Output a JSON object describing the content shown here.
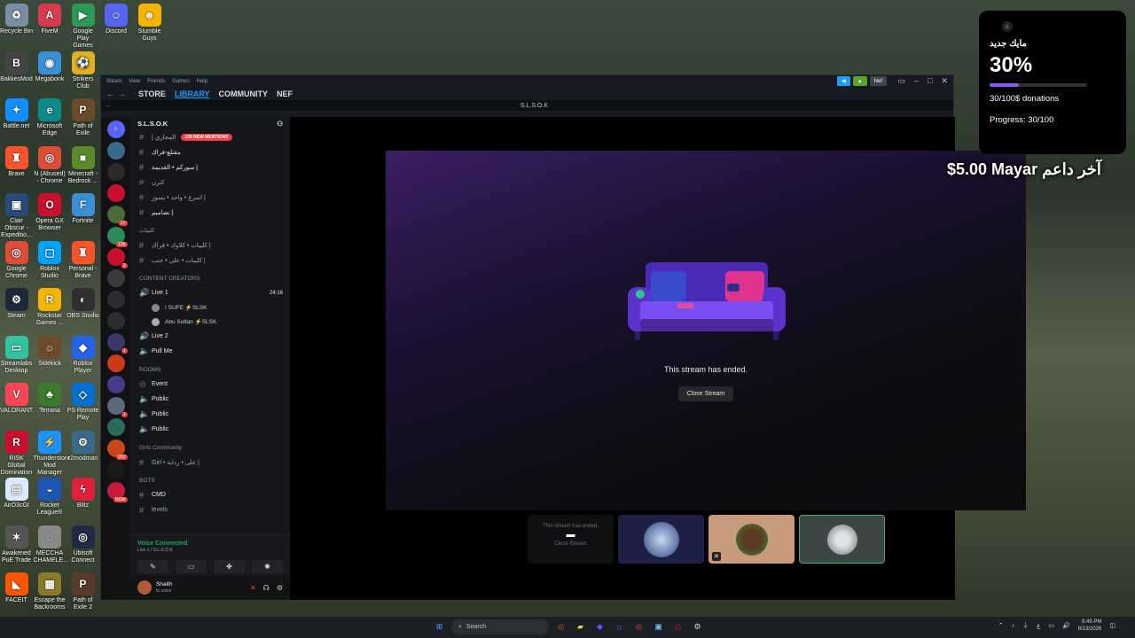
{
  "desktop": {
    "icons": [
      {
        "label": "Recycle Bin",
        "color": "#7b8ea3",
        "glyph": "♻"
      },
      {
        "label": "FiveM",
        "color": "#d63b4f",
        "glyph": "A"
      },
      {
        "label": "Google Play Games",
        "color": "#2a9a55",
        "glyph": "▶"
      },
      {
        "label": "Discord",
        "color": "#5865f2",
        "glyph": "☺"
      },
      {
        "label": "Stumble Guys",
        "color": "#f5b400",
        "glyph": "☻"
      },
      {
        "label": "BakkesMod",
        "color": "#444",
        "glyph": "B"
      },
      {
        "label": "Megabonk",
        "color": "#3a8fd6",
        "glyph": "◉"
      },
      {
        "label": "Strikers Club",
        "color": "#e0b020",
        "glyph": "⚽"
      },
      {
        "label": "Battle.net",
        "color": "#148eff",
        "glyph": "✦"
      },
      {
        "label": "Microsoft Edge",
        "color": "#0c8a8a",
        "glyph": "e"
      },
      {
        "label": "Path of Exile",
        "color": "#6b4b2a",
        "glyph": "P"
      },
      {
        "label": "Brave",
        "color": "#fb542b",
        "glyph": "♜"
      },
      {
        "label": "N (Abused) - Chrome",
        "color": "#dd4b39",
        "glyph": "◎"
      },
      {
        "label": "Minecraft - Bedrock ...",
        "color": "#5a8a2a",
        "glyph": "■"
      },
      {
        "label": "Clair Obscur - Expeditio...",
        "color": "#2a4a7a",
        "glyph": "▣"
      },
      {
        "label": "Opera GX Browser",
        "color": "#c8102e",
        "glyph": "O"
      },
      {
        "label": "Fortnite",
        "color": "#3a8fd6",
        "glyph": "F"
      },
      {
        "label": "Google Chrome",
        "color": "#dd4b39",
        "glyph": "◎"
      },
      {
        "label": "Roblox Studio",
        "color": "#00a2ff",
        "glyph": "▢"
      },
      {
        "label": "Personal - Brave",
        "color": "#fb542b",
        "glyph": "♜"
      },
      {
        "label": "Steam",
        "color": "#1b2838",
        "glyph": "⚙"
      },
      {
        "label": "Rockstar Games ...",
        "color": "#f5b400",
        "glyph": "R"
      },
      {
        "label": "OBS Studio",
        "color": "#302e31",
        "glyph": "◐"
      },
      {
        "label": "Streamlabs Desktop",
        "color": "#31c3a2",
        "glyph": "▭"
      },
      {
        "label": "Sidekick",
        "color": "#6b4b2a",
        "glyph": "☼"
      },
      {
        "label": "Roblox Player",
        "color": "#2563eb",
        "glyph": "◆"
      },
      {
        "label": "VALORANT",
        "color": "#ff4655",
        "glyph": "V"
      },
      {
        "label": "Terraria",
        "color": "#3a7a2a",
        "glyph": "♣"
      },
      {
        "label": "PS Remote Play",
        "color": "#0070d1",
        "glyph": "◇"
      },
      {
        "label": "RISK Global Domination",
        "color": "#c8102e",
        "glyph": "R"
      },
      {
        "label": "Thunderstore Mod Manager",
        "color": "#1e90ff",
        "glyph": "⚡"
      },
      {
        "label": "r2modman",
        "color": "#3a6a8a",
        "glyph": "⚙"
      },
      {
        "label": "AirO3cGt",
        "color": "#dbeafe",
        "glyph": "▤"
      },
      {
        "label": "Rocket League®",
        "color": "#1e56b5",
        "glyph": "◒"
      },
      {
        "label": "Blitz",
        "color": "#e0203a",
        "glyph": "ϟ"
      },
      {
        "label": "Awakened PoE Trade",
        "color": "#555",
        "glyph": "✶"
      },
      {
        "label": "MECCHA CHAMELE...",
        "color": "#888",
        "glyph": "◌"
      },
      {
        "label": "Ubisoft Connect",
        "color": "#1f2a44",
        "glyph": "◎"
      },
      {
        "label": "FACEIT",
        "color": "#ff5500",
        "glyph": "◣"
      },
      {
        "label": "Escape the Backrooms",
        "color": "#8a7a2a",
        "glyph": "▦"
      },
      {
        "label": "Path of Exile 2",
        "color": "#5a3a2a",
        "glyph": "P"
      },
      {
        "label": "Infinite Backroo...",
        "color": "#3a3a3a",
        "glyph": "▥"
      }
    ]
  },
  "steam": {
    "menu": [
      "Steam",
      "View",
      "Friends",
      "Games",
      "Help"
    ],
    "nav": {
      "store": "STORE",
      "library": "LIBRARY",
      "community": "COMMUNITY",
      "user": "NEF"
    },
    "tab_title": "S.L.S.O.K",
    "user_menu": "Nef"
  },
  "discord": {
    "server_name": "S.L.S.O.K",
    "mentions_pill": "126 NEW MENTIONS",
    "channels": [
      {
        "name": "| المجاري",
        "type": "text"
      },
      {
        "name": "مقتلع-فراك",
        "type": "text"
      },
      {
        "name": "سوركم • القديمة |",
        "type": "text"
      },
      {
        "name": "كترن",
        "type": "text"
      },
      {
        "name": "اسرع • واحد • يسور |",
        "type": "text"
      },
      {
        "name": "تصاميم |",
        "type": "text"
      }
    ],
    "cat_links": "كليبات",
    "links_channels": [
      {
        "name": "كليبات • كلاوك • فراك |"
      },
      {
        "name": "كليبات • على • جنب |"
      }
    ],
    "content_creators": "CONTENT CREATORS",
    "voice": [
      {
        "name": "Live 1",
        "time": "24:16",
        "members": [
          "! SUFE ⚡SLSK",
          "Abu Sultan ⚡SLSK"
        ]
      },
      {
        "name": "Live 2"
      },
      {
        "name": "Pull Me"
      }
    ],
    "rooms": "ROOMS",
    "room_channels": [
      "Event",
      "Public",
      "Public",
      "Public"
    ],
    "girls_community": "Girls Community",
    "girl_channel": "Girl • على • رداية |",
    "bots": "BOTS",
    "bot_channels": [
      "CMD",
      "levels"
    ],
    "voice_connected": "Voice Connected",
    "voice_sub": "Live 1 / S.L.S.O.K",
    "user_name": "Shaith",
    "user_status": "In voice",
    "guild_badges": [
      "17",
      "126",
      "2",
      "1",
      "1",
      "262",
      "NEW"
    ]
  },
  "stream": {
    "ended_text": "This stream has ended.",
    "close_label": "Close Stream",
    "tile_ended": "This stream has ended.",
    "tile_close": "Close Stream"
  },
  "overlay": {
    "goal_title": "مايك جديد",
    "percent": "30%",
    "progress_fraction": 0.3,
    "donations": "30/100$ donations",
    "progress": "Progress: 30/100",
    "last_donor": "$5.00 Mayar آخر داعم"
  },
  "taskbar": {
    "search": "Search",
    "lang": "ع",
    "time": "8:49 PM",
    "date": "8/13/2026"
  }
}
